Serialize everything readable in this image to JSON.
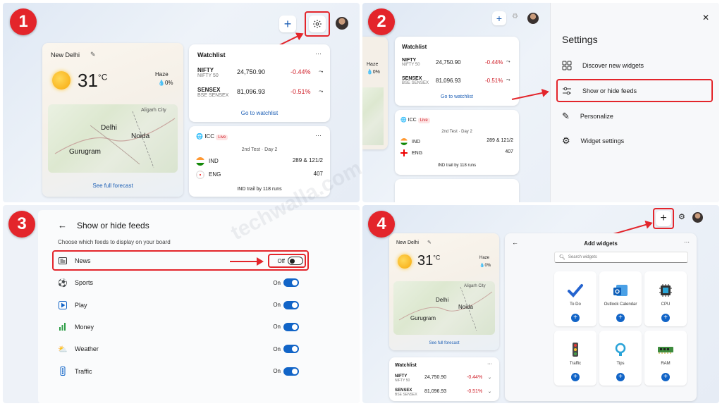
{
  "steps": [
    "1",
    "2",
    "3",
    "4"
  ],
  "step1": {
    "weather": {
      "city": "New Delhi",
      "temp": "31",
      "unit": "°C",
      "condition": "Haze",
      "precip": "0%",
      "see_forecast": "See full forecast",
      "map_labels": [
        "Delhi",
        "Noida",
        "Gurugram",
        "Aligarh City"
      ]
    },
    "watchlist": {
      "title": "Watchlist",
      "more": "···",
      "rows": [
        {
          "name": "NIFTY",
          "sub": "NIFTY 50",
          "value": "24,750.90",
          "change": "-0.44%"
        },
        {
          "name": "SENSEX",
          "sub": "BSE SENSEX",
          "value": "81,096.93",
          "change": "-0.51%"
        }
      ],
      "link": "Go to watchlist"
    },
    "cricket": {
      "org": "ICC",
      "live": "Live",
      "more": "···",
      "match": "2nd Test · Day 2",
      "teams": [
        {
          "name": "IND",
          "score": "289 & 121/2"
        },
        {
          "name": "ENG",
          "score": "407"
        }
      ],
      "status": "IND trail by 118 runs"
    }
  },
  "step2": {
    "settings": {
      "title": "Settings",
      "close": "✕",
      "items": [
        {
          "label": "Discover new widgets",
          "icon": "widgets-icon"
        },
        {
          "label": "Show or hide feeds",
          "icon": "sliders-icon"
        },
        {
          "label": "Personalize",
          "icon": "pencil-icon"
        },
        {
          "label": "Widget settings",
          "icon": "gear-icon"
        }
      ]
    },
    "watchlist": {
      "title": "Watchlist",
      "rows": [
        {
          "name": "NIFTY",
          "sub": "NIFTY 50",
          "value": "24,750.90",
          "change": "-0.44%"
        },
        {
          "name": "SENSEX",
          "sub": "BSE SENSEX",
          "value": "81,096.93",
          "change": "-0.51%"
        }
      ],
      "link": "Go to watchlist"
    },
    "cricket": {
      "org": "ICC",
      "live": "Live",
      "match": "2nd Test · Day 2",
      "teams": [
        {
          "name": "IND",
          "score": "289 & 121/2"
        },
        {
          "name": "ENG",
          "score": "407"
        }
      ],
      "status": "IND trail by 118 runs"
    },
    "partial_weather": {
      "condition": "Haze",
      "precip": "0%"
    }
  },
  "step3": {
    "title": "Show or hide feeds",
    "subtitle": "Choose which feeds to display on your board",
    "feeds": [
      {
        "label": "News",
        "state": "Off",
        "icon": "news-icon"
      },
      {
        "label": "Sports",
        "state": "On",
        "icon": "sports-icon"
      },
      {
        "label": "Play",
        "state": "On",
        "icon": "play-icon"
      },
      {
        "label": "Money",
        "state": "On",
        "icon": "money-icon"
      },
      {
        "label": "Weather",
        "state": "On",
        "icon": "weather-icon"
      },
      {
        "label": "Traffic",
        "state": "On",
        "icon": "traffic-icon"
      }
    ]
  },
  "step4": {
    "weather": {
      "city": "New Delhi",
      "temp": "31",
      "unit": "°C",
      "condition": "Haze",
      "precip": "0%",
      "see_forecast": "See full forecast",
      "map_labels": [
        "Delhi",
        "Noida",
        "Gurugram",
        "Aligarh City"
      ]
    },
    "watchlist": {
      "title": "Watchlist",
      "more": "···",
      "rows": [
        {
          "name": "NIFTY",
          "sub": "NIFTY 50",
          "value": "24,750.90",
          "change": "-0.44%"
        },
        {
          "name": "SENSEX",
          "sub": "BSE SENSEX",
          "value": "81,096.93",
          "change": "-0.51%"
        }
      ]
    },
    "add_widgets": {
      "title": "Add widgets",
      "more": "···",
      "search_placeholder": "Search widgets",
      "tiles": [
        {
          "label": "To Do"
        },
        {
          "label": "Outlook Calendar"
        },
        {
          "label": "CPU"
        },
        {
          "label": "Traffic"
        },
        {
          "label": "Tips"
        },
        {
          "label": "RAM"
        }
      ]
    }
  },
  "watermark": "techwalla.com",
  "colors": {
    "accent": "#1164c7",
    "callout": "#e3252b",
    "negative": "#d0202a"
  }
}
